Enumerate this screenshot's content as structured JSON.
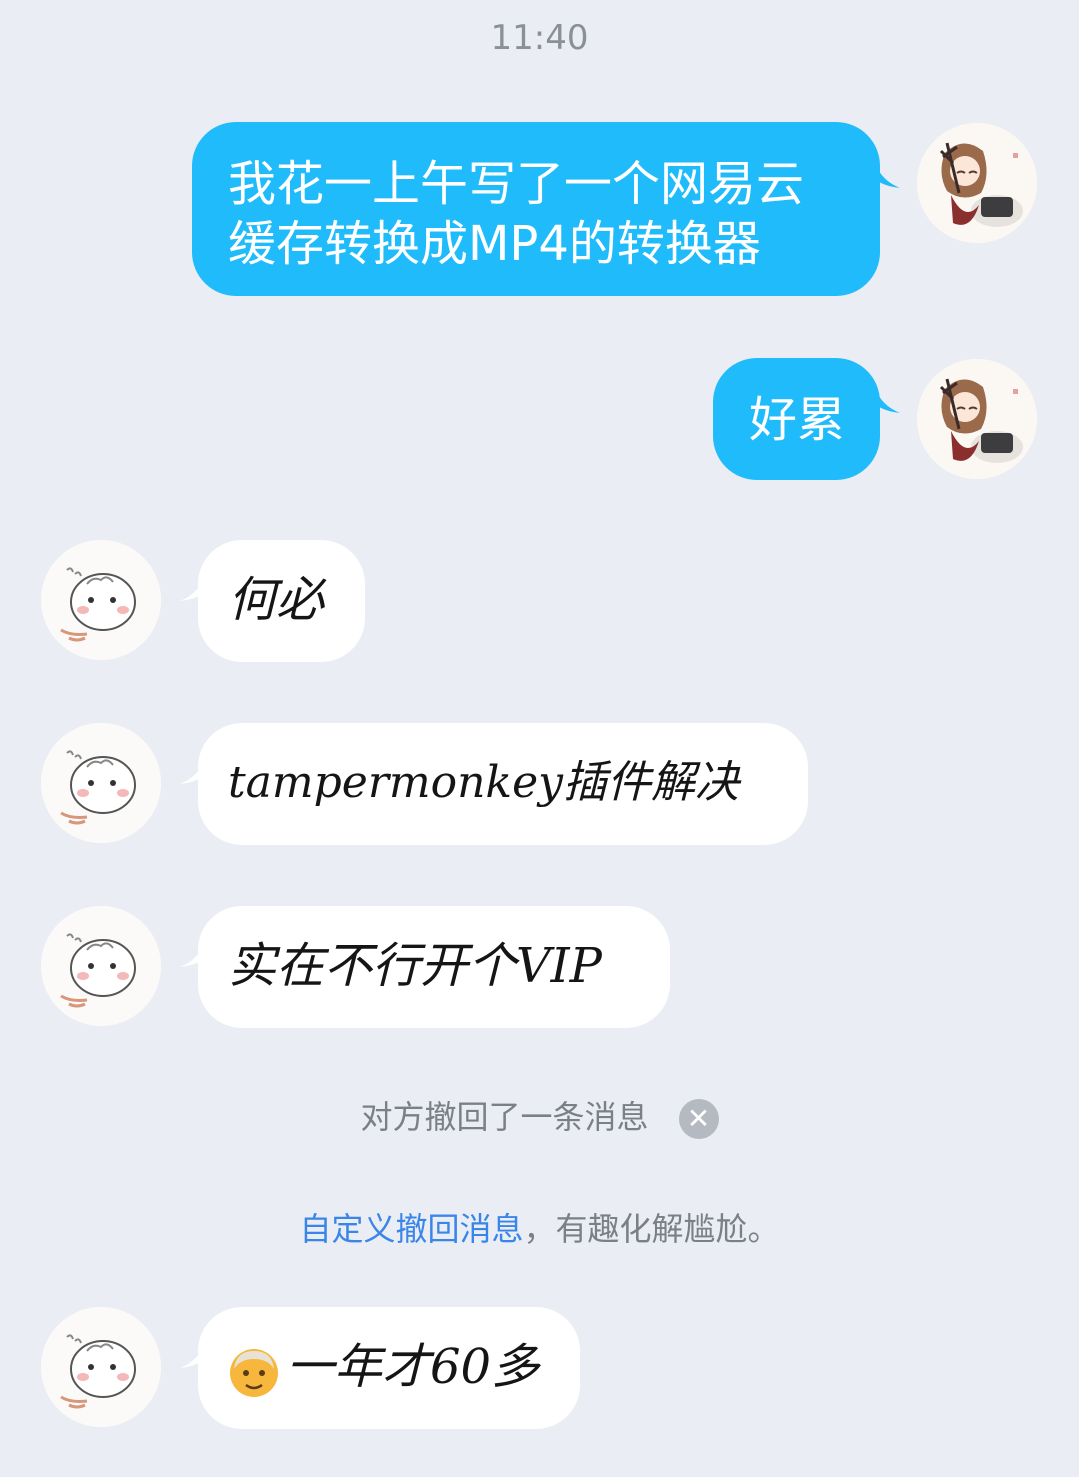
{
  "chat": {
    "time": "11:40",
    "messages": [
      {
        "sender": "me",
        "lines": [
          "我花一上午写了一个网易云",
          "缓存转换成MP4的转换器"
        ]
      },
      {
        "sender": "me",
        "text": "好累"
      },
      {
        "sender": "other",
        "text": "何必"
      },
      {
        "sender": "other",
        "text": "tampermonkey插件解决"
      },
      {
        "sender": "other",
        "text": "实在不行开个VIP"
      },
      {
        "sender": "other",
        "emoji": "old-man-emoji",
        "text": "一年才60多"
      }
    ],
    "system": {
      "recall_notice": "对方撤回了一条消息",
      "recall_close_icon": "close-icon",
      "custom_link": "自定义撤回消息",
      "custom_suffix": "，有趣化解尴尬。"
    },
    "avatars": {
      "me": "anime-girl-avatar",
      "other": "hamster-avatar"
    },
    "colors": {
      "background": "#eaedf4",
      "my_bubble": "#20bbfb",
      "other_bubble": "#ffffff",
      "link": "#3a86e8"
    }
  }
}
